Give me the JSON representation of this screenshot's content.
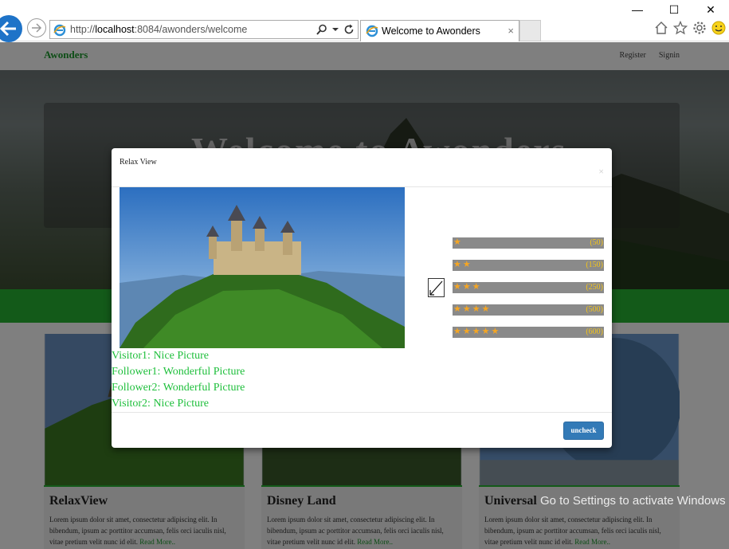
{
  "browser": {
    "url_prefix": "http://",
    "url_host": "localhost",
    "url_rest": ":8084/awonders/welcome",
    "tab_title": "Welcome to Awonders",
    "tab_close": "×",
    "window_minimize": "—",
    "window_maximize": "☐",
    "window_close": "✕"
  },
  "navbar": {
    "brand": "Awonders",
    "register": "Register",
    "signin": "Signin"
  },
  "hero": {
    "title": "Welcome to Awonders"
  },
  "cards": [
    {
      "title": "RelaxView",
      "text": "Lorem ipsum dolor sit amet, consectetur adipiscing elit. In bibendum, ipsum ac porttitor accumsan, felis orci iaculis nisl, vitae pretium velit nunc id elit.",
      "link": "Read More.."
    },
    {
      "title": "Disney Land",
      "text": "Lorem ipsum dolor sit amet, consectetur adipiscing elit. In bibendum, ipsum ac porttitor accumsan, felis orci iaculis nisl, vitae pretium velit nunc id elit.",
      "link": "Read More.."
    },
    {
      "title": "Universal",
      "text": "Lorem ipsum dolor sit amet, consectetur adipiscing elit. In bibendum, ipsum ac porttitor accumsan, felis orci iaculis nisl, vitae pretium velit nunc id elit.",
      "link": "Read More.."
    }
  ],
  "modal": {
    "title": "Relax View",
    "close": "×",
    "button_label": "uncheck",
    "ratings": [
      {
        "stars": "★",
        "count": "(50)"
      },
      {
        "stars": "★★",
        "count": "(150)"
      },
      {
        "stars": "★★★",
        "count": "(250)"
      },
      {
        "stars": "★★★★",
        "count": "(500)"
      },
      {
        "stars": "★★★★★",
        "count": "(600)"
      }
    ],
    "comments": [
      "Visitor1: Nice Picture",
      "Follower1: Wonderful Picture",
      "Follower2: Wonderful Picture",
      "Visitor2: Nice Picture"
    ]
  },
  "watermark": "Go to Settings to activate Windows",
  "colors": {
    "brand_green": "#1a9b2c",
    "band_green": "#27b533",
    "comment_green": "#1fbf3c",
    "star_orange": "#f5a623",
    "button_blue": "#337ab7"
  }
}
